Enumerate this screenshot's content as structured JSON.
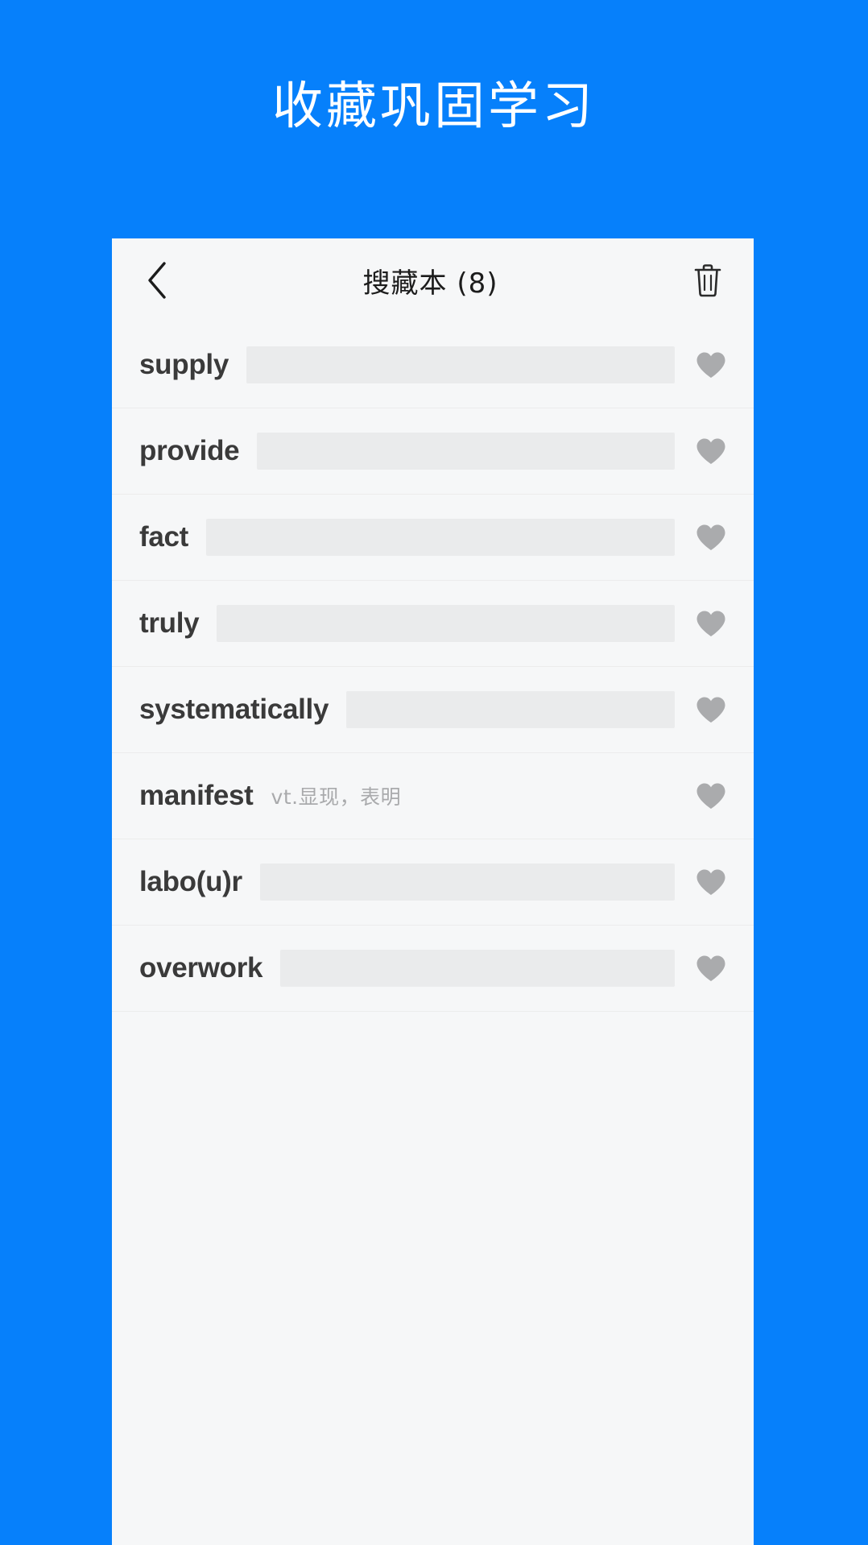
{
  "promo": {
    "headline": "收藏巩固学习",
    "background_color": "#0680fb",
    "headline_color": "#ffffff"
  },
  "app": {
    "card_background": "#f6f7f8",
    "header": {
      "back_icon": "chevron-left-icon",
      "title": "搜藏本 (8)",
      "delete_icon": "trash-icon"
    },
    "list": {
      "hidden_placeholder_color": "#eaebec",
      "favorite_icon": "heart-filled-icon",
      "favorite_color": "#aaabad",
      "items": [
        {
          "term": "supply",
          "meaning": "",
          "meaning_hidden": true,
          "favorited": true
        },
        {
          "term": "provide",
          "meaning": "",
          "meaning_hidden": true,
          "favorited": true
        },
        {
          "term": "fact",
          "meaning": "",
          "meaning_hidden": true,
          "favorited": true
        },
        {
          "term": "truly",
          "meaning": "",
          "meaning_hidden": true,
          "favorited": true
        },
        {
          "term": "systematically",
          "meaning": "",
          "meaning_hidden": true,
          "favorited": true
        },
        {
          "term": "manifest",
          "meaning": "vt.显现，表明",
          "meaning_hidden": false,
          "favorited": true
        },
        {
          "term": "labo(u)r",
          "meaning": "",
          "meaning_hidden": true,
          "favorited": true
        },
        {
          "term": "overwork",
          "meaning": "",
          "meaning_hidden": true,
          "favorited": true
        }
      ]
    }
  }
}
